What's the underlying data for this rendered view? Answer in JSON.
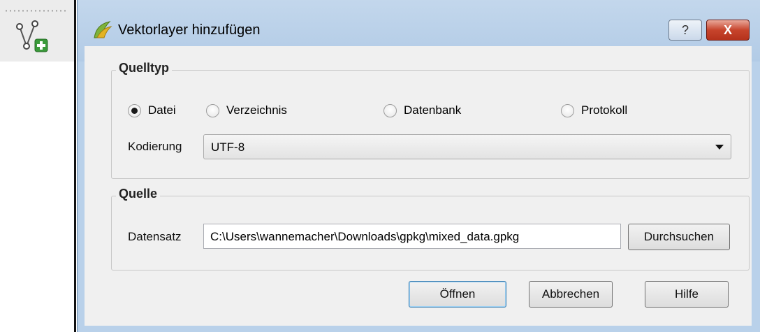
{
  "window": {
    "title": "Vektorlayer hinzufügen",
    "help_button": "?",
    "close_button": "X"
  },
  "source_type": {
    "title": "Quelltyp",
    "options": [
      {
        "label": "Datei",
        "checked": true
      },
      {
        "label": "Verzeichnis",
        "checked": false
      },
      {
        "label": "Datenbank",
        "checked": false
      },
      {
        "label": "Protokoll",
        "checked": false
      }
    ],
    "encoding_label": "Kodierung",
    "encoding_value": "UTF-8"
  },
  "source": {
    "title": "Quelle",
    "dataset_label": "Datensatz",
    "dataset_value": "C:\\Users\\wannemacher\\Downloads\\gpkg\\mixed_data.gpkg",
    "browse_button": "Durchsuchen"
  },
  "buttons": {
    "open": "Öffnen",
    "cancel": "Abbrechen",
    "help": "Hilfe"
  },
  "icons": {
    "toolbar": "add-vector-layer-icon",
    "title": "qgis-logo-icon"
  }
}
